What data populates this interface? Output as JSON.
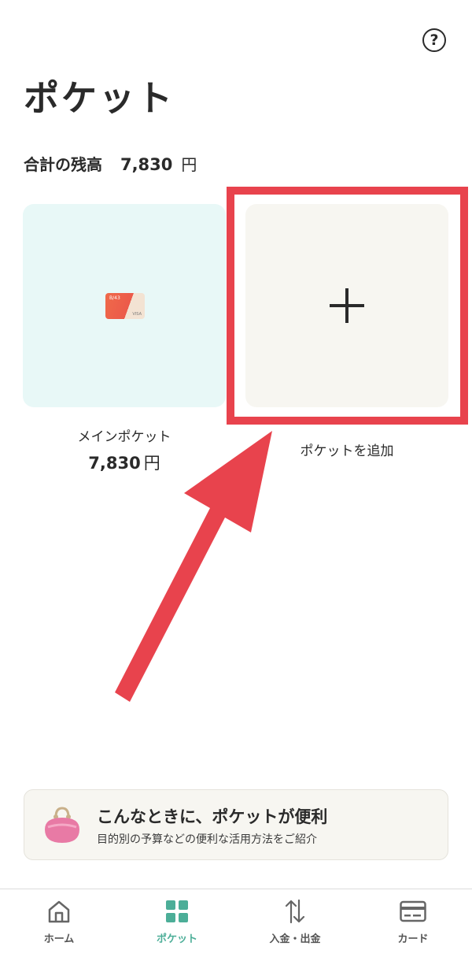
{
  "header": {
    "help_symbol": "?",
    "title": "ポケット"
  },
  "summary": {
    "label": "合計の残高",
    "amount": "7,830",
    "unit": "円"
  },
  "main_pocket": {
    "card": {
      "bank_text": "B/43",
      "brand_text": "VISA"
    },
    "name": "メインポケット",
    "amount": "7,830",
    "unit": "円"
  },
  "add_pocket": {
    "label": "ポケットを追加"
  },
  "promo": {
    "title": "こんなときに、ポケットが便利",
    "subtitle": "目的別の予算などの便利な活用方法をご紹介"
  },
  "tabs": [
    {
      "label": "ホーム",
      "icon": "home-icon"
    },
    {
      "label": "ポケット",
      "icon": "grid-icon"
    },
    {
      "label": "入金・出金",
      "icon": "transfer-arrows-icon"
    },
    {
      "label": "カード",
      "icon": "card-icon"
    }
  ],
  "active_tab": "ポケット",
  "colors": {
    "accent": "#4cae98",
    "highlight": "#e8434d",
    "main_pocket_bg": "#e8f8f7",
    "add_tile_bg": "#f7f6f1"
  }
}
